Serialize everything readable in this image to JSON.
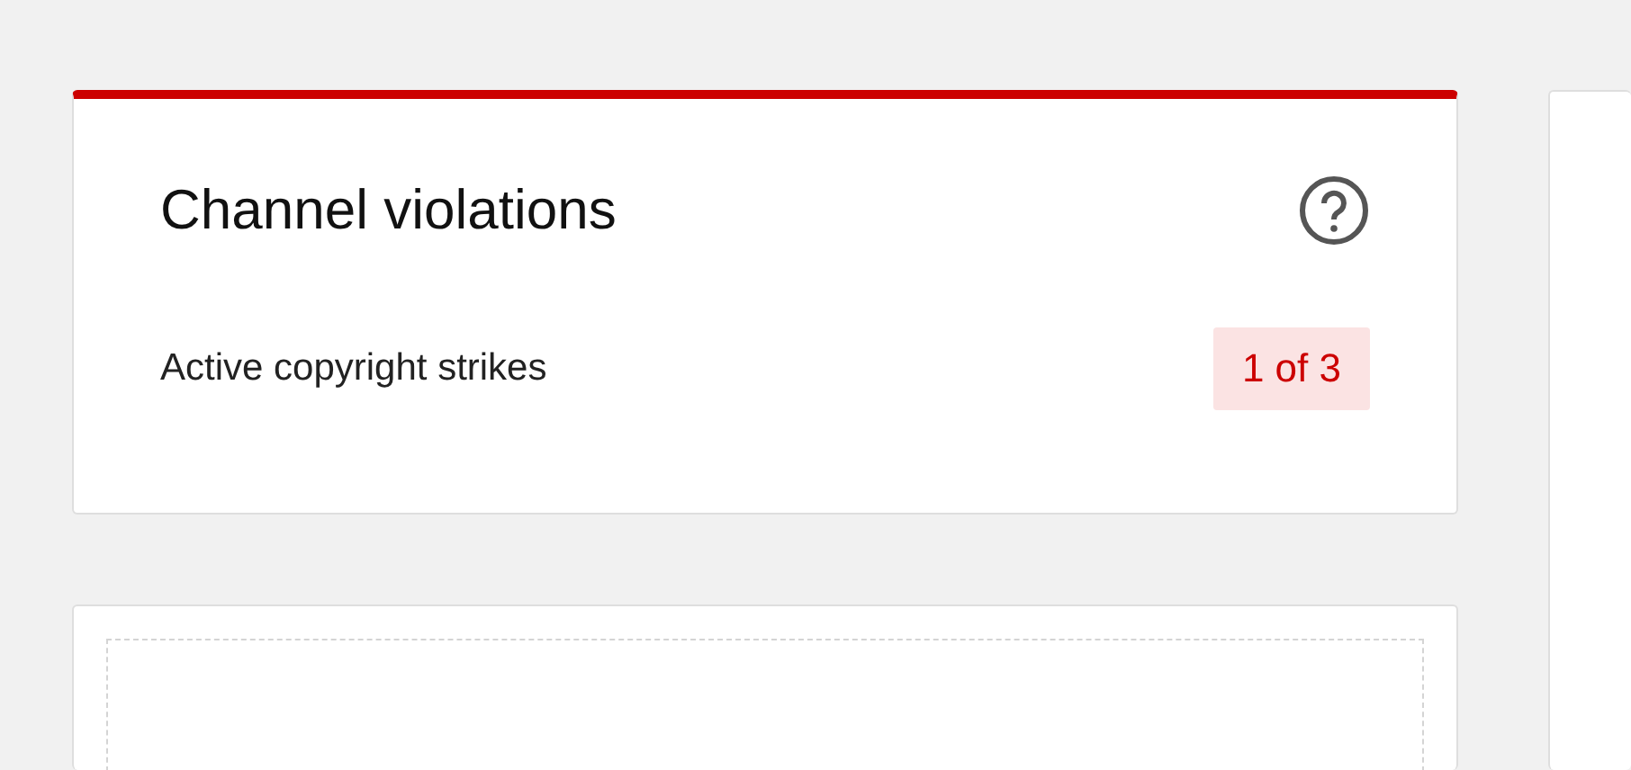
{
  "violations_card": {
    "title": "Channel violations",
    "rows": [
      {
        "label": "Active copyright strikes",
        "badge": "1 of 3"
      }
    ]
  }
}
